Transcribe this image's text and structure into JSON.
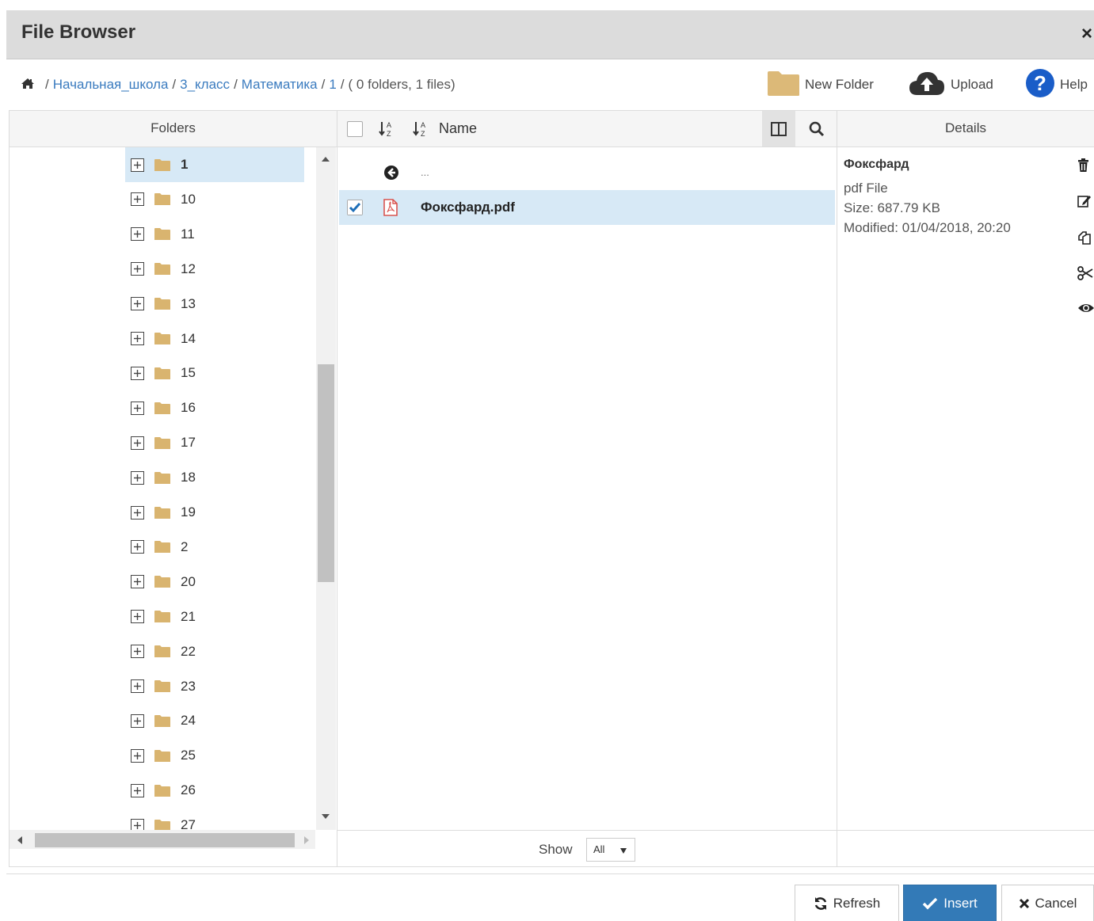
{
  "dialog": {
    "title": "File Browser",
    "close_label": "×"
  },
  "breadcrumb": {
    "segments": [
      "Начальная_школа",
      "3_класс",
      "Математика",
      "1"
    ],
    "summary": "( 0 folders, 1 files)"
  },
  "toolbar": {
    "new_folder_label": "New Folder",
    "upload_label": "Upload",
    "help_label": "Help"
  },
  "folders": {
    "header": "Folders",
    "items": [
      "1",
      "10",
      "11",
      "12",
      "13",
      "14",
      "15",
      "16",
      "17",
      "18",
      "19",
      "2",
      "20",
      "21",
      "22",
      "23",
      "24",
      "25",
      "26",
      "27"
    ],
    "selected": "1"
  },
  "files": {
    "name_column": "Name",
    "parent_label": "...",
    "rows": [
      {
        "name": "Фоксфард.pdf",
        "type": "pdf",
        "checked": true
      }
    ],
    "show_label": "Show",
    "show_value": "All"
  },
  "details": {
    "header": "Details",
    "name": "Фоксфард",
    "type": "pdf File",
    "size": "Size: 687.79 KB",
    "modified": "Modified: 01/04/2018, 20:20"
  },
  "footer": {
    "refresh_label": "Refresh",
    "insert_label": "Insert",
    "cancel_label": "Cancel"
  },
  "colors": {
    "link": "#3a7bbf",
    "selected_row": "#d7e9f6",
    "folder": "#d9b46f",
    "primary": "#337ab7",
    "pdf_red": "#d9534f"
  }
}
